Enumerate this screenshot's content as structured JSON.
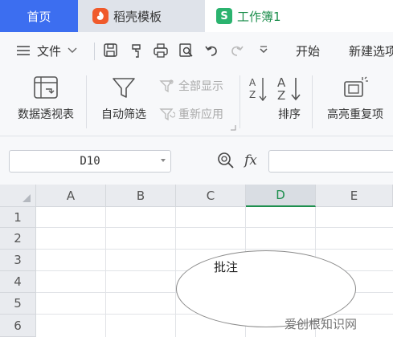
{
  "tabs": {
    "home": "首页",
    "docer": "稻壳模板",
    "workbook": "工作簿1",
    "workbook_icon_letter": "S"
  },
  "menu": {
    "file": "文件",
    "start": "开始",
    "new_item": "新建选项"
  },
  "ribbon": {
    "pivot": "数据透视表",
    "autofilter": "自动筛选",
    "show_all": "全部显示",
    "reapply": "重新应用",
    "sort": "排序",
    "highlight_dup": "高亮重复项"
  },
  "formula": {
    "cell_ref": "D10",
    "fx": "fx",
    "value": ""
  },
  "sheet": {
    "columns": [
      "A",
      "B",
      "C",
      "D",
      "E"
    ],
    "active_column": "D",
    "rows": [
      "1",
      "2",
      "3",
      "4",
      "5",
      "6"
    ]
  },
  "shape": {
    "type": "ellipse",
    "text": "批注"
  },
  "watermark": "爱创根知识网",
  "colors": {
    "accent_blue": "#3c6ef0",
    "accent_green": "#1e8f4e",
    "docer_orange": "#f05a2b"
  }
}
